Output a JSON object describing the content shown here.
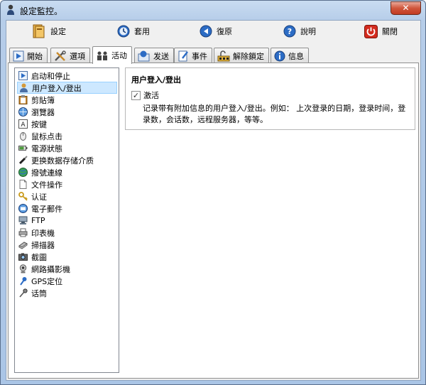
{
  "window": {
    "title": "設定監控。",
    "close_glyph": "✕"
  },
  "toolbar": {
    "buttons": [
      {
        "label": "設定",
        "icon": "settings-book-icon"
      },
      {
        "label": "套用",
        "icon": "apply-clock-icon"
      },
      {
        "label": "復原",
        "icon": "restore-icon"
      },
      {
        "label": "說明",
        "icon": "help-icon"
      },
      {
        "label": "關閉",
        "icon": "power-icon"
      }
    ]
  },
  "tabs": [
    {
      "label": "開始",
      "icon": "play-icon",
      "active": false
    },
    {
      "label": "選項",
      "icon": "tools-icon",
      "active": false
    },
    {
      "label": "活动",
      "icon": "activity-icon",
      "active": true
    },
    {
      "label": "发送",
      "icon": "send-icon",
      "active": false
    },
    {
      "label": "事件",
      "icon": "event-icon",
      "active": false
    },
    {
      "label": "解除鎖定",
      "icon": "unlock-icon",
      "active": false
    },
    {
      "label": "信息",
      "icon": "info-icon",
      "active": false
    }
  ],
  "activity_list": {
    "selected_index": 1,
    "items": [
      "启动和停止",
      "用户登入/登出",
      "剪貼簿",
      "瀏覽器",
      "按键",
      "鼠标点击",
      "電源狀態",
      "更换数据存储介质",
      "撥號連線",
      "文件操作",
      "认证",
      "電子郵件",
      "FTP",
      "印表機",
      "掃描器",
      "截圖",
      "網路攝影機",
      "GPS定位",
      "话筒"
    ]
  },
  "detail": {
    "title": "用户登入/登出",
    "checkbox_label": "激活",
    "checkbox_checked": true,
    "description": "记录带有附加信息的用户登入/登出。例如： 上次登录的日期，登录时间，登录数，会话数，远程服务器，等等。"
  },
  "colors": {
    "selection": "#cde8ff",
    "close_red": "#c23b22",
    "accent_blue": "#2c6cc5"
  }
}
